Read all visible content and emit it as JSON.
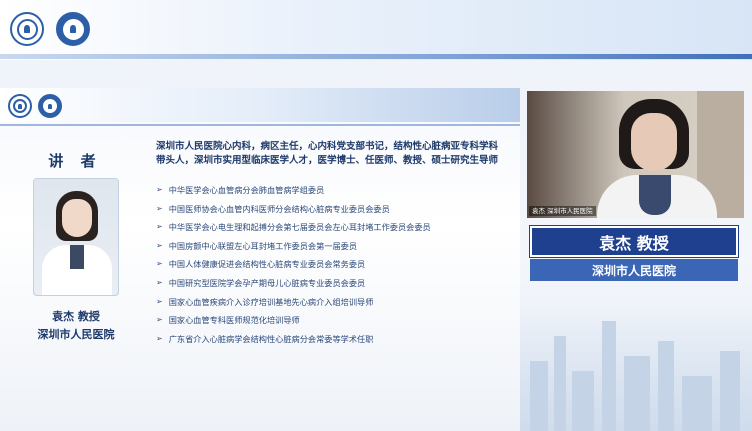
{
  "header": {
    "logos": [
      "shenzhen-medical-logo",
      "association-logo"
    ]
  },
  "slide": {
    "logos": [
      "shenzhen-medical-logo",
      "association-logo"
    ],
    "speaker_heading": "讲 者",
    "speaker_name": "袁杰 教授",
    "speaker_org": "深圳市人民医院",
    "bio": "深圳市人民医院心内科，病区主任，心内科党支部书记，结构性心脏病亚专科学科带头人，深圳市实用型临床医学人才，医学博士、任医师、教授、硕士研究生导师",
    "roles": [
      "中华医学会心血管病分会肺血管病学组委员",
      "中国医师协会心血管内科医师分会结构心脏病专业委员会委员",
      "中华医学会心电生理和起搏分会第七届委员会左心耳封堵工作委员会委员",
      "中国房颤中心联盟左心耳封堵工作委员会第一届委员",
      "中国人体健康促进会结构性心脏病专业委员会常务委员",
      "中国研究型医院学会孕产期母儿心脏病专业委员会委员",
      "国家心血管疾病介入诊疗培训基地先心病介入组培训导师",
      "国家心血管专科医师规范化培训导师",
      "广东省介入心脏病学会结构性心脏病分会常委等学术任职"
    ]
  },
  "video": {
    "caption": "袁杰 深圳市人民医院",
    "nameplate": "袁杰 教授",
    "org": "深圳市人民医院"
  },
  "colors": {
    "navy": "#1f3f8f",
    "accent_blue": "#3b66b5",
    "text_blue": "#1e3a6b"
  }
}
